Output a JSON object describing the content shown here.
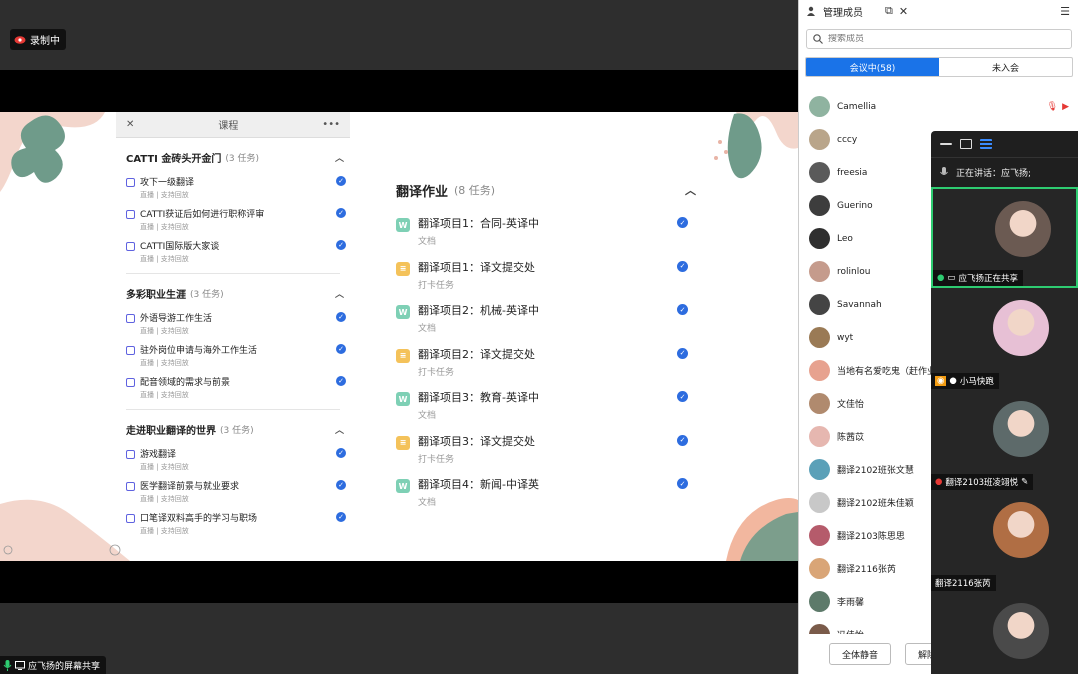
{
  "recording": {
    "label": "录制中"
  },
  "share_footer": {
    "label": "应飞扬的屏幕共享"
  },
  "course": {
    "topbar_title": "课程",
    "status_text": "直播 | 支持回放",
    "sections": [
      {
        "title": "CATTI 金砖头开金门",
        "count": "(3 任务)",
        "lessons": [
          "攻下一级翻译",
          "CATTI获证后如何进行职称评审",
          "CATTI国际版大家谈"
        ]
      },
      {
        "title": "多彩职业生涯",
        "count": "(3 任务)",
        "lessons": [
          "外语导游工作生活",
          "驻外岗位申请与海外工作生活",
          "配音领域的需求与前景"
        ]
      },
      {
        "title": "走进职业翻译的世界",
        "count": "(3 任务)",
        "lessons": [
          "游戏翻译",
          "医学翻译前景与就业要求",
          "口笔译双料高手的学习与职场"
        ]
      }
    ]
  },
  "tasks": {
    "title": "翻译作业",
    "count": "(8 任务)",
    "items": [
      {
        "name": "翻译项目1：合同-英译中",
        "sub": "文档",
        "type": "doc"
      },
      {
        "name": "翻译项目1：译文提交处",
        "sub": "打卡任务",
        "type": "card"
      },
      {
        "name": "翻译项目2：机械-英译中",
        "sub": "文档",
        "type": "doc"
      },
      {
        "name": "翻译项目2：译文提交处",
        "sub": "打卡任务",
        "type": "card"
      },
      {
        "name": "翻译项目3：教育-英译中",
        "sub": "文档",
        "type": "doc"
      },
      {
        "name": "翻译项目3：译文提交处",
        "sub": "打卡任务",
        "type": "card"
      },
      {
        "name": "翻译项目4：新闻-中译英",
        "sub": "文档",
        "type": "doc"
      }
    ]
  },
  "members_panel": {
    "title": "管理成员",
    "search_placeholder": "搜索成员",
    "tab_in_meeting": "会议中(58)",
    "tab_not_joined": "未入会",
    "members": [
      {
        "name": "Camellia",
        "color": "#8fb3a0"
      },
      {
        "name": "cccy",
        "color": "#b9a58a"
      },
      {
        "name": "freesia",
        "color": "#5a5a5a"
      },
      {
        "name": "Guerino",
        "color": "#3d3d3d"
      },
      {
        "name": "Leo",
        "color": "#2f2f2f"
      },
      {
        "name": "rolinlou",
        "color": "#c59b8c"
      },
      {
        "name": "Savannah",
        "color": "#444444"
      },
      {
        "name": "wyt",
        "color": "#9a7a55"
      },
      {
        "name": "当地有名爱吃鬼（赶作业",
        "color": "#e7a28f"
      },
      {
        "name": "文佳怡",
        "color": "#b08a6e"
      },
      {
        "name": "陈茜苡",
        "color": "#e6b7b0"
      },
      {
        "name": "翻译2102班张文慧",
        "color": "#5aa0b8"
      },
      {
        "name": "翻译2102班朱佳颖",
        "color": "#c8c8c8"
      },
      {
        "name": "翻译2103陈思思",
        "color": "#b55b6b"
      },
      {
        "name": "翻译2116张芮",
        "color": "#d9a577"
      },
      {
        "name": "李雨馨",
        "color": "#5d7a6a"
      },
      {
        "name": "冯佳怡",
        "color": "#7a5b4a"
      }
    ],
    "mute_all": "全体静音",
    "unmute_all": "解除"
  },
  "gallery": {
    "speaking_prefix": "正在讲话：",
    "speaking_name": "应飞扬;",
    "tiles": [
      {
        "label": "应飞扬正在共享",
        "color": "#6b5a52"
      },
      {
        "label": "小马快跑",
        "color": "#e7c0d5"
      },
      {
        "label": "翻译2103班凌翊悦",
        "color": "#5d6a6a"
      },
      {
        "label": "翻译2116张芮",
        "color": "#b06e44"
      },
      {
        "label": "",
        "color": "#4a4a4a"
      }
    ]
  }
}
